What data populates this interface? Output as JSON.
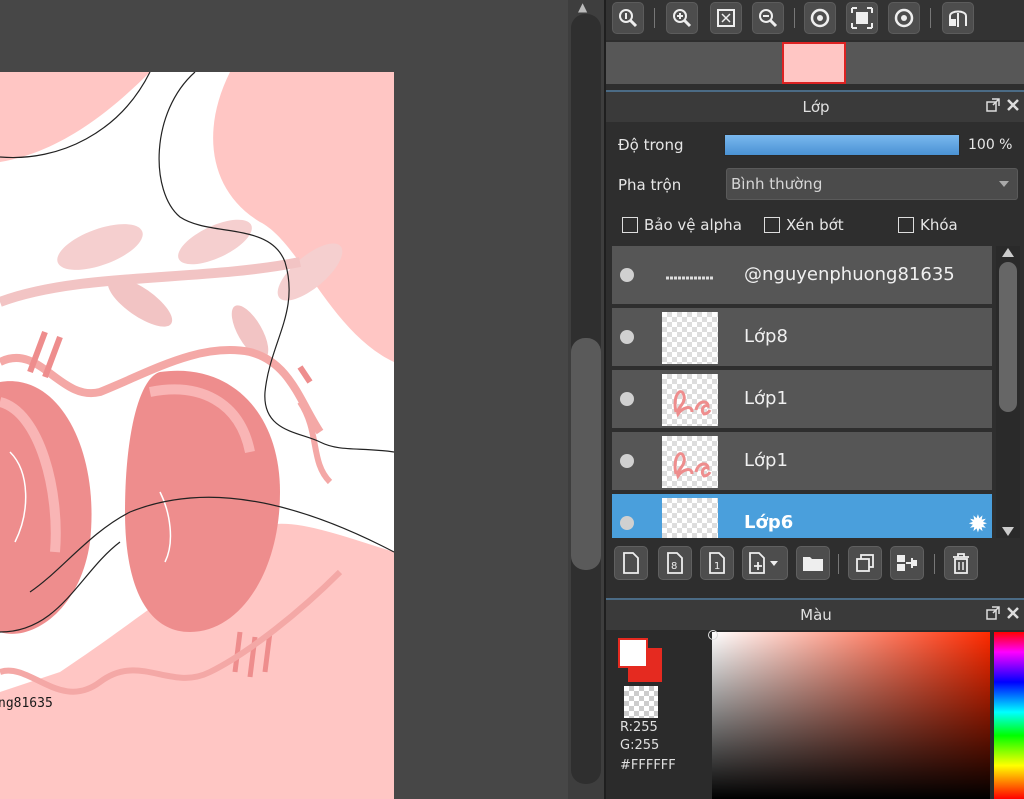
{
  "canvas": {
    "watermark": "ng81635",
    "colors": {
      "paper": "#ffc6c4",
      "workspace": "#474747"
    }
  },
  "navigator": {
    "buttons": [
      "zoom-actual-icon",
      "zoom-in-icon",
      "fit-screen-icon",
      "zoom-out-icon",
      "rotate-left-icon",
      "fullscreen-icon",
      "rotate-right-icon",
      "flip-icon"
    ]
  },
  "layer_panel": {
    "title": "Lớp",
    "opacity_label": "Độ trong",
    "opacity_value": "100 %",
    "opacity_percent": 100,
    "blend_label": "Pha trộn",
    "blend_value": "Bình thường",
    "checkboxes": {
      "protect_alpha": "Bảo vệ alpha",
      "clipping": "Xén bớt",
      "lock": "Khóa"
    },
    "layers": [
      {
        "name": "@nguyenphuong81635",
        "selected": false
      },
      {
        "name": "Lớp8",
        "selected": false
      },
      {
        "name": "Lớp1",
        "selected": false
      },
      {
        "name": "Lớp1",
        "selected": false
      },
      {
        "name": "Lớp6",
        "selected": true
      }
    ],
    "accent_color": "#4a9fdc"
  },
  "color_panel": {
    "title": "Màu",
    "r": "R:255",
    "g": "G:255",
    "hex": "#FFFFFF",
    "foreground": "#ffffff",
    "background": "#e52a20"
  }
}
